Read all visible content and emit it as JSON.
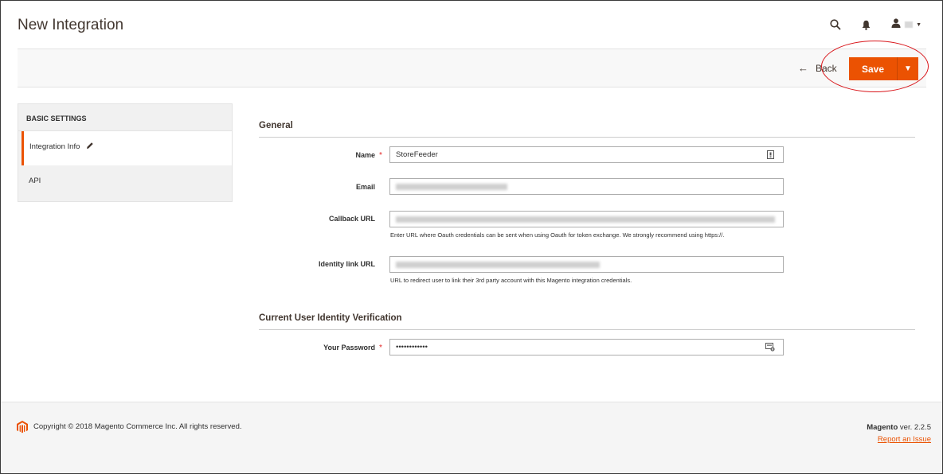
{
  "header": {
    "title": "New Integration",
    "icons": [
      "search-icon",
      "bell-icon",
      "user-icon",
      "caret-down-icon"
    ]
  },
  "actions": {
    "back_label": "Back",
    "save_label": "Save",
    "accent_color": "#eb5202"
  },
  "sidebar": {
    "title": "BASIC SETTINGS",
    "items": [
      {
        "label": "Integration Info",
        "active": true
      },
      {
        "label": "API",
        "active": false
      }
    ]
  },
  "form": {
    "general": {
      "title": "General",
      "name": {
        "label": "Name",
        "value": "StoreFeeder",
        "required": true
      },
      "email": {
        "label": "Email",
        "value": ""
      },
      "callback_url": {
        "label": "Callback URL",
        "value": "",
        "note": "Enter URL where Oauth credentials can be sent when using Oauth for token exchange. We strongly recommend using https://."
      },
      "identity_link_url": {
        "label": "Identity link URL",
        "value": "",
        "note": "URL to redirect user to link their 3rd party account with this Magento integration credentials."
      }
    },
    "verification": {
      "title": "Current User Identity Verification",
      "password": {
        "label": "Your Password",
        "value": "••••••••••••",
        "required": true
      }
    }
  },
  "footer": {
    "copyright": "Copyright © 2018 Magento Commerce Inc. All rights reserved.",
    "brand": "Magento",
    "version": " ver. 2.2.5",
    "report_link": "Report an Issue"
  }
}
